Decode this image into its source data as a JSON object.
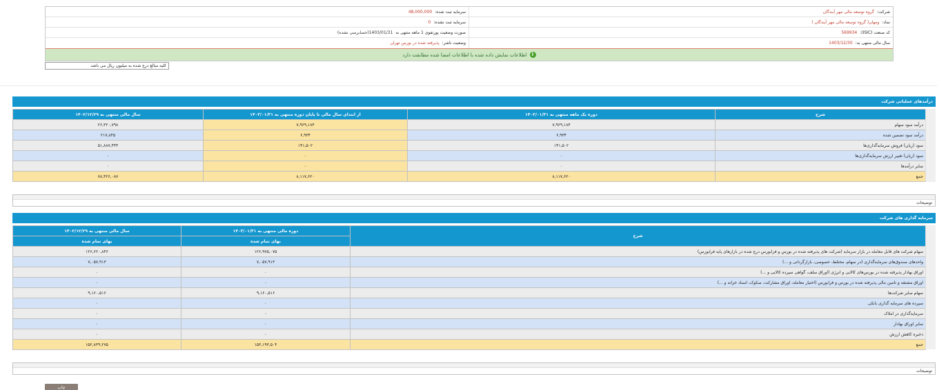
{
  "header": {
    "company_label": "شرکت:",
    "company_value": "گروه توسعه مالی مهر آیندگان",
    "registered_capital_label": "سرمایه ثبت شده:",
    "registered_capital_value": "48,000,000",
    "symbol_label": "نماد:",
    "symbol_value": "ومهان( گروه توسعه مالی مهر آیندگان )",
    "unregistered_capital_label": "سرمایه ثبت نشده:",
    "unregistered_capital_value": "0",
    "isic_label": "کد صنعت (ISIC):",
    "isic_value": "569934",
    "status_label": "صورت وضعیت پورتفوی 1 ماهه منتهی به",
    "status_value": "1403/01/31(حسابرسی نشده)",
    "fiscal_year_label": "سال مالی منتهی به:",
    "fiscal_year_value": "1403/12/30",
    "publisher_status_label": "وضعیت ناشر:",
    "publisher_status_value": "پذیرفته شده در بورس تهران"
  },
  "notice": {
    "icon": "info-icon",
    "text": "اطلاعات نمایش داده شده با اطلاعات امضا شده مطابقت دارد"
  },
  "unit_select": {
    "value": "کلیه مبالغ درج شده به میلیون ریال می باشد"
  },
  "operating_income": {
    "title": "درآمدهای عملیاتی شرکت",
    "headers": [
      "شرح",
      "دوره یک ماهه منتهی به ۱۴۰۳/۰۱/۳۱",
      "از ابتدای سال مالی تا پایان دوره منتهی به ۱۴۰۳/۰۱/۳۱",
      "سال مالی منتهی به ۱۴۰۲/۱۲/۲۹"
    ],
    "rows": [
      {
        "label": "درآمد سود سهام",
        "c1": "۷,۹۶۹,۱۸۴",
        "c2": "۷,۹۶۹,۱۸۴",
        "c3": "۲۶,۳۲۰,۷۹۸"
      },
      {
        "label": "درآمد سود تضمین شده",
        "c1": "۶,۹۳۴",
        "c2": "۶,۹۳۴",
        "c3": "۲۱۷,۸۴۵"
      },
      {
        "label": "سود (زیان) فروش سرمایه‌گذاری‌ها",
        "c1": "۱۴۱,۵۰۲",
        "c2": "۱۴۱,۵۰۲",
        "c3": "۵۱,۸۸۷,۴۴۴"
      },
      {
        "label": "سود (زیان) تغییر ارزش سرمایه‌گذاری‌ها",
        "c1": "۰",
        "c2": "۰",
        "c3": "۰"
      },
      {
        "label": "سایر درآمدها",
        "c1": "۰",
        "c2": "۰",
        "c3": "۰"
      }
    ],
    "total": {
      "label": "جمع",
      "c1": "۸,۱۱۷,۶۲۰",
      "c2": "۸,۱۱۷,۶۲۰",
      "c3": "۷۸,۴۲۶,۰۸۷"
    }
  },
  "notes1": {
    "label": "توضیحات"
  },
  "investments": {
    "title": "سرمایه گذاری های شرکت",
    "headers": {
      "desc": "شرح",
      "p1": "دوره مالی منتهی به ۱۴۰۳/۰۱/۳۱",
      "p2": "سال مالی منتهی به ۱۴۰۲/۱۲/۲۹",
      "sub1": "بهای تمام شده",
      "sub2": "بهای تمام شده"
    },
    "rows": [
      {
        "label": "سهام شرکت های قابل معامله در بازار سرمایه (شرکت های پذیرفته شده در بورس و فرابورس درج شده در بازارهای پایه فرابورس)",
        "c1": "۱۲۶,۹۷۵,۰۷۵",
        "c2": "۱۲۶,۶۲۰,۸۴۶"
      },
      {
        "label": "واحدهای صندوق‌های سرمایه‌گذاری (در سهام، مختلط، خصوصی، بازارگردانی و ...)",
        "c1": "۷,۰۵۷,۹۱۳",
        "c2": "۷,۰۵۷,۹۱۳"
      },
      {
        "label": "اوراق بهادار پذیرفته شده در بورس‌های کالایی و انرژی (اوراق سلف، گواهی سپرده کالایی و ...)",
        "c1": "۰",
        "c2": "۰"
      },
      {
        "label": "اوراق مشتقه و تامین مالی پذیرفته شده در بورس و فرابورس (اختیار معامله، اوراق مشارکت، صکوک، اسناد خزانه و ...)",
        "c1": "۰",
        "c2": "۰"
      },
      {
        "label": "سهام سایر شرکت‌ها",
        "c1": "۹,۱۶۰,۵۱۶",
        "c2": "۹,۱۶۰,۵۱۶"
      },
      {
        "label": "سپرده های سرمایه گذاری بانکی",
        "c1": "۰",
        "c2": "۰"
      },
      {
        "label": "سرمایه‌گذاری در املاک",
        "c1": "۰",
        "c2": "۰"
      },
      {
        "label": "سایر اوراق بهادار",
        "c1": "۰",
        "c2": "۰"
      },
      {
        "label": "ذخیره کاهش ارزش",
        "c1": "۰",
        "c2": "۰"
      }
    ],
    "total": {
      "label": "جمع",
      "c1": "۱۵۳,۱۹۳,۵۰۴",
      "c2": "۱۵۲,۸۳۹,۲۷۵"
    }
  },
  "notes2": {
    "label": "توضیحات"
  },
  "print_button": {
    "label": "چاپ"
  }
}
